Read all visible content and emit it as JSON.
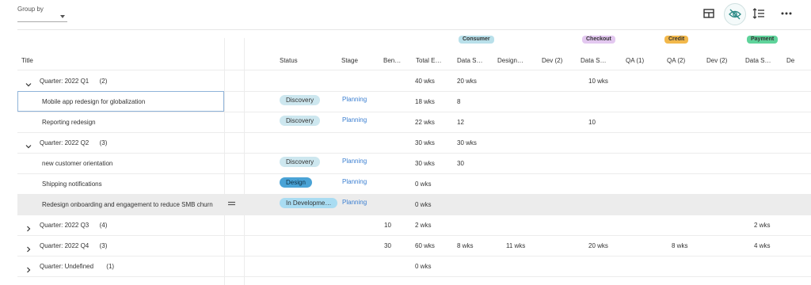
{
  "toolbar": {
    "group_by_label": "Group by",
    "group_by_value": ""
  },
  "teams": [
    {
      "name": "Consumer",
      "color": "#b9e0ea"
    },
    {
      "name": "Checkout",
      "color": "#e3c8f0"
    },
    {
      "name": "Credit",
      "color": "#f2b84b"
    },
    {
      "name": "Payment",
      "color": "#5fd39b"
    }
  ],
  "columns": {
    "title": "Title",
    "status": "Status",
    "stage": "Stage",
    "benefit": "Ben…",
    "total_effort": "Total E…",
    "consumer_data_s": "Data S…",
    "consumer_design": "Design…",
    "consumer_dev": "Dev (2)",
    "checkout_data_s": "Data S…",
    "checkout_qa": "QA (1)",
    "credit_qa": "QA (2)",
    "credit_dev": "Dev (2)",
    "payment_data_s": "Data S…",
    "payment_overflow": "De"
  },
  "rows": [
    {
      "kind": "group",
      "title": "Quarter: 2022 Q1",
      "count": "(2)",
      "expanded": true,
      "benefit": "",
      "total": "40 wks",
      "c1": "20 wks",
      "c2": "",
      "c3": "",
      "c4": "10 wks",
      "c5": "",
      "c6": "",
      "c7": "",
      "c8": ""
    },
    {
      "kind": "item",
      "title": "Mobile app redesign for globalization",
      "status": "Discovery",
      "status_color": "#cde7ef",
      "stage": "Planning",
      "benefit": "",
      "total": "18 wks",
      "c1": "8",
      "c2": "",
      "c3": "",
      "c4": "",
      "c5": "",
      "c6": "",
      "c7": "",
      "c8": ""
    },
    {
      "kind": "item",
      "title": "Reporting redesign",
      "status": "Discovery",
      "status_color": "#cde7ef",
      "stage": "Planning",
      "benefit": "",
      "total": "22 wks",
      "c1": "12",
      "c2": "",
      "c3": "",
      "c4": "10",
      "c5": "",
      "c6": "",
      "c7": "",
      "c8": ""
    },
    {
      "kind": "group",
      "title": "Quarter: 2022 Q2",
      "count": "(3)",
      "expanded": true,
      "benefit": "",
      "total": "30 wks",
      "c1": "30 wks",
      "c2": "",
      "c3": "",
      "c4": "",
      "c5": "",
      "c6": "",
      "c7": "",
      "c8": ""
    },
    {
      "kind": "item",
      "title": "new customer orientation",
      "status": "Discovery",
      "status_color": "#cde7ef",
      "stage": "Planning",
      "benefit": "",
      "total": "30 wks",
      "c1": "30",
      "c2": "",
      "c3": "",
      "c4": "",
      "c5": "",
      "c6": "",
      "c7": "",
      "c8": ""
    },
    {
      "kind": "item",
      "title": "Shipping notifications",
      "status": "Design",
      "status_color": "#4aa3d6",
      "stage": "Planning",
      "benefit": "",
      "total": "0 wks",
      "c1": "",
      "c2": "",
      "c3": "",
      "c4": "",
      "c5": "",
      "c6": "",
      "c7": "",
      "c8": ""
    },
    {
      "kind": "item",
      "title": "Redesign onboarding and engagement to reduce SMB churn",
      "status": "In Developme…",
      "status_color": "#a9dcf2",
      "stage": "Planning",
      "benefit": "",
      "total": "0 wks",
      "c1": "",
      "c2": "",
      "c3": "",
      "c4": "",
      "c5": "",
      "c6": "",
      "c7": "",
      "c8": ""
    },
    {
      "kind": "group",
      "title": "Quarter: 2022 Q3",
      "count": "(4)",
      "expanded": false,
      "benefit": "10",
      "total": "2 wks",
      "c1": "",
      "c2": "",
      "c3": "",
      "c4": "",
      "c5": "",
      "c6": "",
      "c7": "",
      "c8": "2 wks"
    },
    {
      "kind": "group",
      "title": "Quarter: 2022 Q4",
      "count": "(3)",
      "expanded": false,
      "benefit": "30",
      "total": "60 wks",
      "c1": "8 wks",
      "c2": "11 wks",
      "c3": "",
      "c4": "20 wks",
      "c5": "",
      "c6": "8 wks",
      "c7": "",
      "c8": "4 wks"
    },
    {
      "kind": "group",
      "title": "Quarter: Undefined",
      "count": "(1)",
      "expanded": false,
      "benefit": "",
      "total": "0 wks",
      "c1": "",
      "c2": "",
      "c3": "",
      "c4": "",
      "c5": "",
      "c6": "",
      "c7": "",
      "c8": ""
    }
  ],
  "icons": {
    "layout": "layout-icon",
    "hide": "eye-off-icon",
    "row_height": "row-height-icon",
    "more": "more-icon",
    "drag": "drag-handle-icon",
    "expand": "chevron-down-icon",
    "collapse": "chevron-right-icon"
  }
}
